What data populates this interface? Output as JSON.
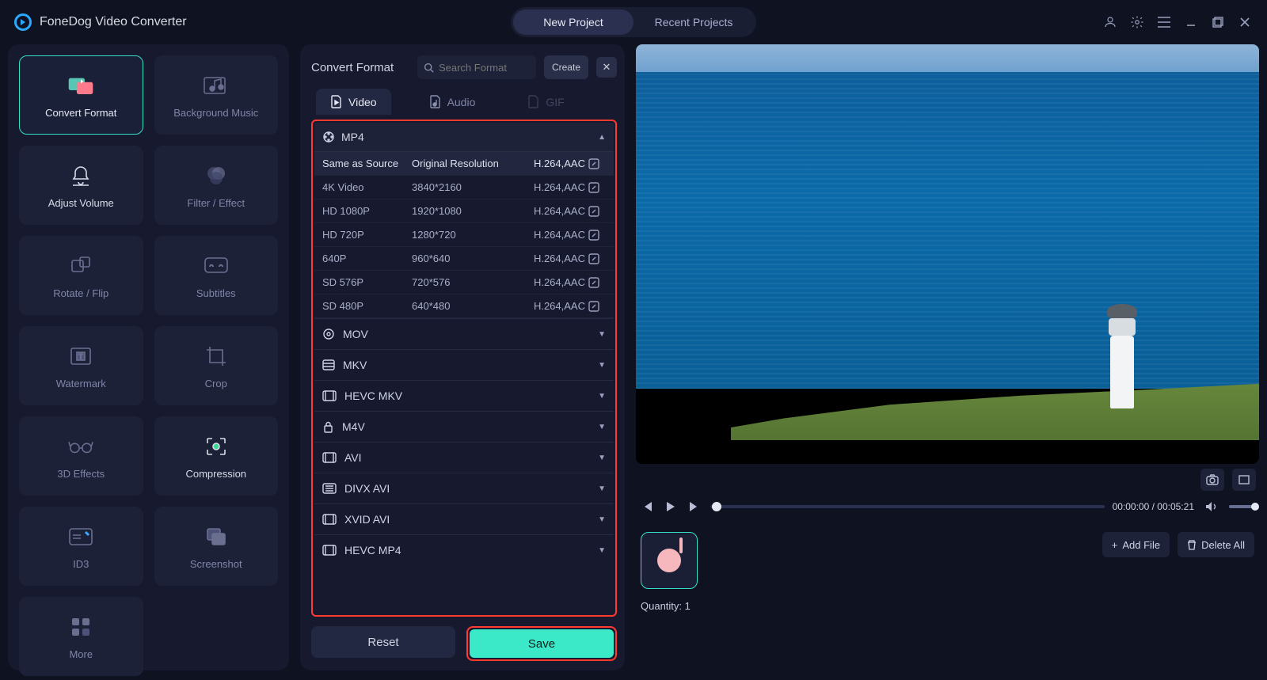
{
  "app": {
    "title": "FoneDog Video Converter"
  },
  "topTabs": {
    "new": "New Project",
    "recent": "Recent Projects"
  },
  "tools": {
    "convert": "Convert Format",
    "bgmusic": "Background Music",
    "volume": "Adjust Volume",
    "filter": "Filter / Effect",
    "rotate": "Rotate / Flip",
    "subtitles": "Subtitles",
    "watermark": "Watermark",
    "crop": "Crop",
    "fx3d": "3D Effects",
    "compress": "Compression",
    "id3": "ID3",
    "screenshot": "Screenshot",
    "more": "More"
  },
  "mid": {
    "title": "Convert Format",
    "searchPlaceholder": "Search Format",
    "create": "Create",
    "tabs": {
      "video": "Video",
      "audio": "Audio",
      "gif": "GIF"
    },
    "expanded": {
      "name": "MP4",
      "header": {
        "c1": "Same as Source",
        "c2": "Original Resolution",
        "c3": "H.264,AAC"
      },
      "rows": [
        {
          "c1": "4K Video",
          "c2": "3840*2160",
          "c3": "H.264,AAC"
        },
        {
          "c1": "HD 1080P",
          "c2": "1920*1080",
          "c3": "H.264,AAC"
        },
        {
          "c1": "HD 720P",
          "c2": "1280*720",
          "c3": "H.264,AAC"
        },
        {
          "c1": "640P",
          "c2": "960*640",
          "c3": "H.264,AAC"
        },
        {
          "c1": "SD 576P",
          "c2": "720*576",
          "c3": "H.264,AAC"
        },
        {
          "c1": "SD 480P",
          "c2": "640*480",
          "c3": "H.264,AAC"
        }
      ]
    },
    "collapsed": [
      "MOV",
      "MKV",
      "HEVC MKV",
      "M4V",
      "AVI",
      "DIVX AVI",
      "XVID AVI",
      "HEVC MP4"
    ],
    "reset": "Reset",
    "save": "Save"
  },
  "player": {
    "time": "00:00:00 / 00:05:21"
  },
  "queue": {
    "addFile": "Add File",
    "deleteAll": "Delete All",
    "quantityLabel": "Quantity:",
    "quantityValue": "1"
  }
}
